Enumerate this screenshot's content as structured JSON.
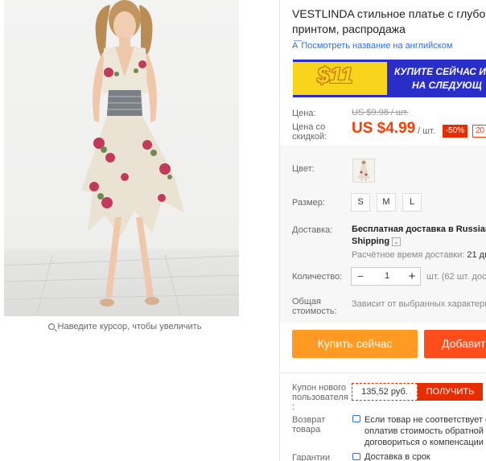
{
  "product": {
    "image_alt": "",
    "zoom_hint": "Наведите курсор, чтобы увеличить",
    "title_line1": "VESTLINDA стильное платье с глубоким",
    "title_line2": "принтом, распродажа",
    "translate_link": "Посмотреть название на английском",
    "translate_icon": "translate-icon"
  },
  "banner": {
    "big_text": "$11",
    "line1": "КУПИТЕ СЕЙЧАС И",
    "line2": "НА СЛЕДУЮЩ"
  },
  "price": {
    "label": "Цена:",
    "old": "US $9.98 / шт.",
    "discount_label_1": "Цена со",
    "discount_label_2": "скидкой:",
    "new": "US $4.99",
    "unit": "/ шт.",
    "discount": "-50%",
    "extra_badge": "20"
  },
  "options": {
    "color_label": "Цвет:",
    "size_label": "Размер:",
    "sizes": [
      "S",
      "M",
      "L"
    ]
  },
  "shipping": {
    "label": "Доставка:",
    "method_line1": "Бесплатная доставка в Russian F",
    "method_line2": "Shipping",
    "caret": "⌄",
    "time_label": "Расчётное время доставки:",
    "time_value": "21 дн"
  },
  "quantity": {
    "label": "Количество:",
    "value": "1",
    "minus": "−",
    "plus": "+",
    "available": "шт. (62 шт. дос"
  },
  "total": {
    "label_1": "Общая",
    "label_2": "стоимость:",
    "value": "Зависит от выбранных характери"
  },
  "actions": {
    "buy_now": "Купить сейчас",
    "add_to_cart": "Добавит"
  },
  "coupon": {
    "label_1": "Купон нового",
    "label_2": "пользователя",
    "label_3": ":",
    "amount": "135,52 руб.",
    "get": "ПОЛУЧИТЬ"
  },
  "returns": {
    "label_1": "Возврат",
    "label_2": "товара",
    "line1": "Если товар не соответствует о",
    "line2": "оплатив стоимость обратной п",
    "line3": "договориться о компенсации с"
  },
  "guarantee": {
    "label": "Гарантии",
    "text": "Доставка в срок"
  },
  "colors": {
    "price_red": "#f0410a",
    "discount_red": "#e62e04",
    "buy_orange": "#ff9b22",
    "cart_orange": "#ff4d1c",
    "banner_blue": "#2a2ec9",
    "banner_yellow": "#f8d51c",
    "link_blue": "#2f6fdb"
  }
}
